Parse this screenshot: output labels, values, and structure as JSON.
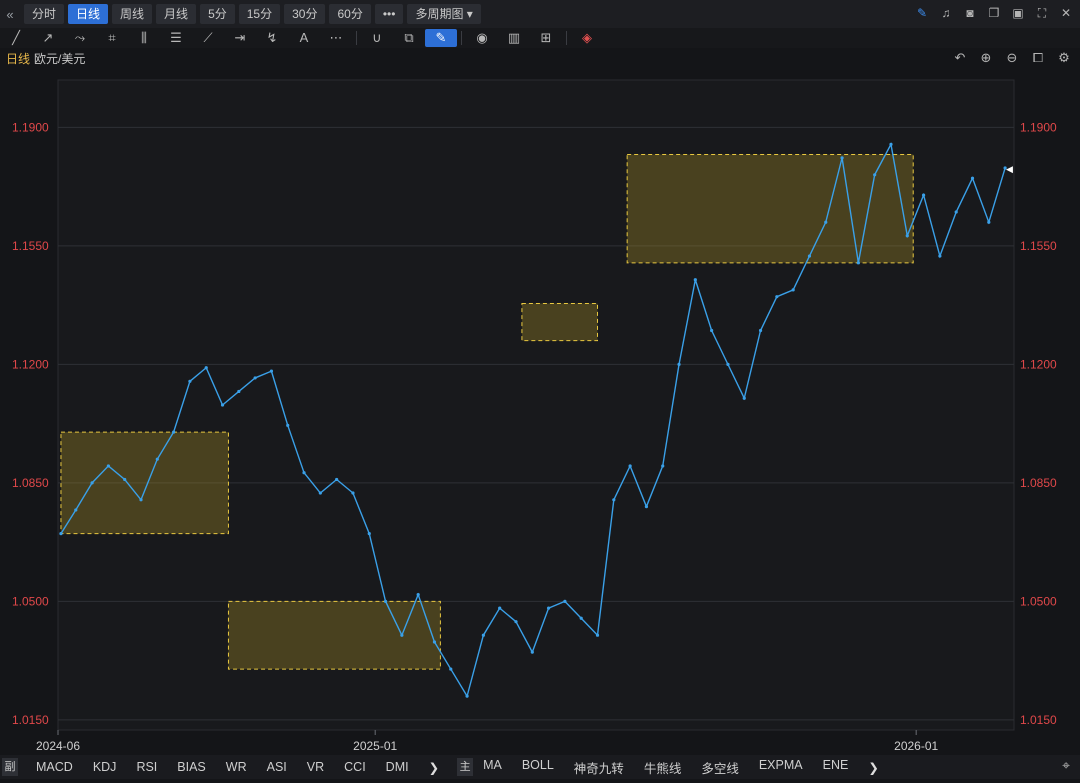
{
  "topbar": {
    "nav_icon": "double-chevron-left-icon",
    "periods": [
      {
        "label": "分时",
        "active": false
      },
      {
        "label": "日线",
        "active": true
      },
      {
        "label": "周线",
        "active": false
      },
      {
        "label": "月线",
        "active": false
      },
      {
        "label": "5分",
        "active": false
      },
      {
        "label": "15分",
        "active": false
      },
      {
        "label": "30分",
        "active": false
      },
      {
        "label": "60分",
        "active": false
      }
    ],
    "more_label": "•••",
    "multi_period_label": "多周期图",
    "right_icons": [
      "pen-icon",
      "bell-icon",
      "camera-icon",
      "copy-window-icon",
      "screen-icon",
      "fullscreen-icon",
      "close-icon"
    ]
  },
  "toolbar": {
    "tools": [
      "line-icon",
      "ray-icon",
      "polyline-icon",
      "crop-icon",
      "parallel-lines-icon",
      "fib-icon",
      "fan-icon",
      "range-icon",
      "wave-icon",
      "text-icon",
      "more-icon",
      "magnet-icon",
      "layers-icon",
      "pen-icon",
      "eye-icon",
      "trash-icon",
      "grid-icon",
      "ruler-icon"
    ]
  },
  "title": {
    "period": "日线",
    "symbol": "欧元/美元"
  },
  "chart_controls": [
    "undo-icon",
    "zoom-in-icon",
    "zoom-out-icon",
    "layout-icon",
    "settings-icon"
  ],
  "chart_data": {
    "type": "line",
    "title": "欧元/美元",
    "xlabel": "",
    "ylabel": "",
    "ylim": [
      1.012,
      1.204
    ],
    "y_ticks": [
      "1.1900",
      "1.1550",
      "1.1200",
      "1.0850",
      "1.0500",
      "1.0150"
    ],
    "x_ticks": [
      "2024-06",
      "2025-01",
      "2026-01"
    ],
    "line_color": "#3aa0e8",
    "series": [
      {
        "x": [
          "2024-06-03",
          "2024-06-13",
          "2024-06-24",
          "2024-07-05",
          "2024-07-16",
          "2024-07-27",
          "2024-08-07",
          "2024-08-18",
          "2024-08-29",
          "2024-09-09",
          "2024-09-20",
          "2024-10-01",
          "2024-10-12",
          "2024-10-23",
          "2024-11-03",
          "2024-11-14",
          "2024-11-25",
          "2024-12-06",
          "2024-12-17",
          "2024-12-28",
          "2025-01-08",
          "2025-01-19",
          "2025-01-30",
          "2025-02-10",
          "2025-02-21",
          "2025-03-04",
          "2025-03-15",
          "2025-03-26",
          "2025-04-06",
          "2025-04-17",
          "2025-04-28",
          "2025-05-09",
          "2025-05-20",
          "2025-05-31",
          "2025-06-11",
          "2025-06-22",
          "2025-07-03",
          "2025-07-14",
          "2025-07-25",
          "2025-08-05",
          "2025-08-16",
          "2025-08-27",
          "2025-09-07",
          "2025-09-18",
          "2025-09-29",
          "2025-10-10",
          "2025-10-21",
          "2025-11-01",
          "2025-11-12",
          "2025-11-23",
          "2025-12-04",
          "2025-12-15",
          "2025-12-26",
          "2026-01-06",
          "2026-01-17",
          "2026-01-28",
          "2026-02-08",
          "2026-02-19",
          "2026-03-02"
        ],
        "values": [
          1.07,
          1.077,
          1.085,
          1.09,
          1.086,
          1.08,
          1.092,
          1.1,
          1.115,
          1.119,
          1.108,
          1.112,
          1.116,
          1.118,
          1.102,
          1.088,
          1.082,
          1.086,
          1.082,
          1.07,
          1.05,
          1.04,
          1.052,
          1.038,
          1.03,
          1.022,
          1.04,
          1.048,
          1.044,
          1.035,
          1.048,
          1.05,
          1.045,
          1.04,
          1.08,
          1.09,
          1.078,
          1.09,
          1.12,
          1.145,
          1.13,
          1.12,
          1.11,
          1.13,
          1.14,
          1.142,
          1.152,
          1.162,
          1.181,
          1.15,
          1.176,
          1.185,
          1.158,
          1.17,
          1.152,
          1.165,
          1.175,
          1.162,
          1.178
        ]
      }
    ],
    "annotations": {
      "boxes": [
        {
          "x0": "2024-06-03",
          "x1": "2024-09-24",
          "y0": 1.07,
          "y1": 1.1
        },
        {
          "x0": "2024-09-24",
          "x1": "2025-02-14",
          "y0": 1.03,
          "y1": 1.05
        },
        {
          "x0": "2025-04-10",
          "x1": "2025-05-31",
          "y0": 1.127,
          "y1": 1.138
        },
        {
          "x0": "2025-06-20",
          "x1": "2025-12-30",
          "y0": 1.15,
          "y1": 1.182
        }
      ],
      "box_color": "#e8c840",
      "zigzag_color": "#e8c840"
    },
    "last_price_marker": "◀"
  },
  "bottombar": {
    "sub_tag": "副",
    "sub_indicators": [
      "MACD",
      "KDJ",
      "RSI",
      "BIAS",
      "WR",
      "ASI",
      "VR",
      "CCI",
      "DMI"
    ],
    "main_tag": "主",
    "main_indicators": [
      "MA",
      "BOLL",
      "神奇九转",
      "牛熊线",
      "多空线",
      "EXPMA",
      "ENE"
    ],
    "more_label": "❯",
    "location_icon": "map-pin-icon"
  }
}
